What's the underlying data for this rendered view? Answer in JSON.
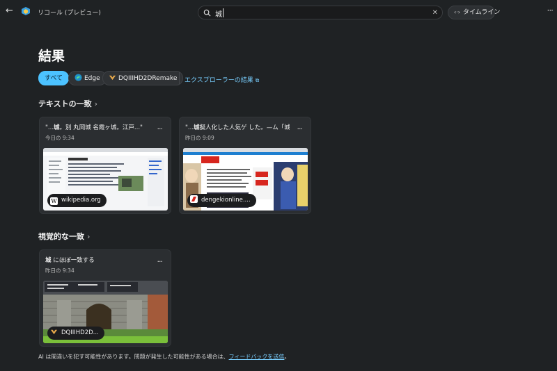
{
  "titlebar": {
    "app_title": "リコール (プレビュー)",
    "search_value": "城",
    "timeline_label": "タイムライン"
  },
  "heading": "結果",
  "filters": {
    "all": "すべて",
    "edge": "Edge",
    "game": "DQIIIHD2DRemake",
    "explorer_link": "エクスプローラーの結果"
  },
  "text_section": {
    "title": "テキストの一致",
    "cards": [
      {
        "title_pre": "\"...",
        "title_bold": "城",
        "title_post": "。別 丸岡城 名霞ヶ城。江戸...\"",
        "time": "今日の 9:34",
        "source": "wikipedia.org"
      },
      {
        "title_pre": "\"...",
        "title_bold": "城",
        "title_post": "擬人化した人気ゲ した。—ム「城姫...\"",
        "time": "昨日の 9:09",
        "source": "dengekionline...."
      }
    ]
  },
  "visual_section": {
    "title": "視覚的な一致",
    "cards": [
      {
        "title_bold": "城",
        "title_post": " にほぼ一致する",
        "time": "昨日の 9:34",
        "source": "DQIIIHD2D..."
      }
    ]
  },
  "disclaimer": {
    "text": "AI は間違いを犯す可能性があります。問題が発生した可能性がある場合は、",
    "link": "フィードバックを送信",
    "end": "。"
  },
  "colors": {
    "accent": "#4cc2ff",
    "background": "#1f2224",
    "card": "#2b2e31"
  }
}
